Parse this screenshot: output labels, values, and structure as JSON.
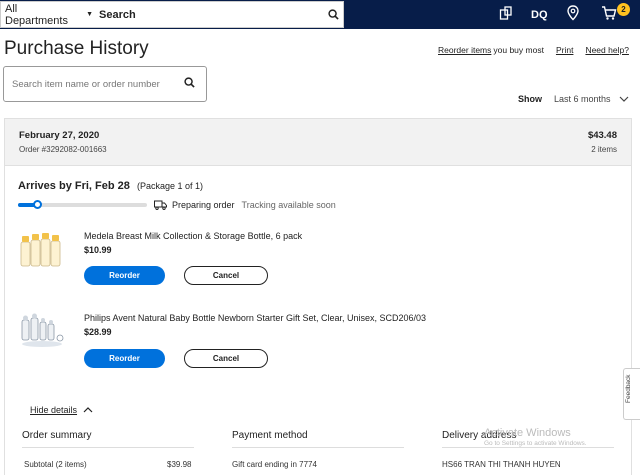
{
  "topbar": {
    "department_label": "All Departments",
    "search_label": "Search",
    "initials": "DQ",
    "cart_count": "2"
  },
  "page": {
    "title": "Purchase History",
    "links": {
      "reorder": "Reorder items",
      "reorder_suffix": "you buy most",
      "print": "Print",
      "help": "Need help?"
    }
  },
  "item_search": {
    "placeholder": "Search item name or order number"
  },
  "filter": {
    "show_label": "Show",
    "selected": "Last 6 months"
  },
  "order": {
    "date": "February 27, 2020",
    "number": "Order #3292082-001663",
    "total": "$43.48",
    "item_count": "2 items",
    "arrives": "Arrives by Fri, Feb 28",
    "package": "(Package 1 of 1)",
    "progress": 0.15,
    "status": "Preparing order",
    "tracking": "Tracking available soon",
    "items": [
      {
        "title": "Medela Breast Milk Collection & Storage Bottle, 6 pack",
        "price": "$10.99",
        "reorder": "Reorder",
        "cancel": "Cancel"
      },
      {
        "title": "Philips Avent Natural Baby Bottle Newborn Starter Gift Set, Clear, Unisex, SCD206/03",
        "price": "$28.99",
        "reorder": "Reorder",
        "cancel": "Cancel"
      }
    ],
    "hide_details": "Hide details"
  },
  "summary": {
    "order_summary": "Order summary",
    "subtotal_label": "Subtotal (2 items)",
    "subtotal_value": "$39.98",
    "payment_method": "Payment method",
    "payment_detail": "Gift card ending in 7774",
    "delivery_address": "Delivery address",
    "delivery_name": "HS66 TRAN THI THANH HUYEN"
  },
  "feedback_label": "Feedback",
  "watermark": {
    "line1": "Activate Windows",
    "line2": "Go to Settings to activate Windows."
  }
}
